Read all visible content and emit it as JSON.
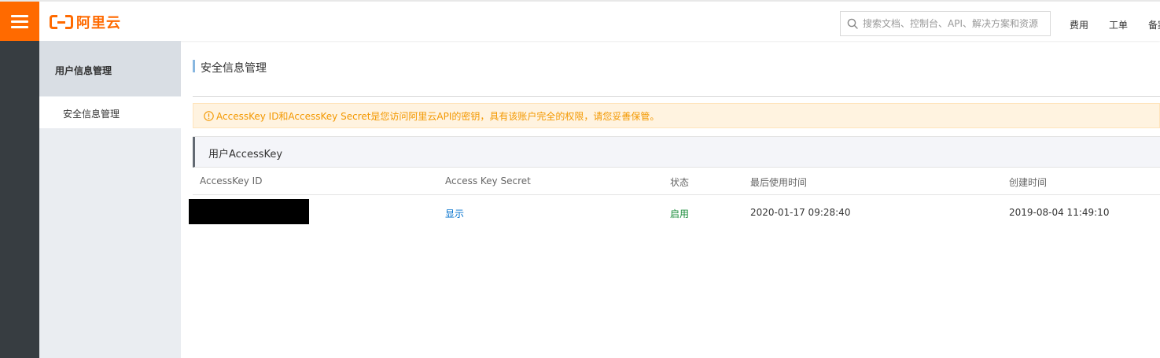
{
  "header": {
    "logo_text": "阿里云",
    "search_placeholder": "搜索文档、控制台、API、解决方案和资源",
    "links": [
      "费用",
      "工单",
      "备案"
    ]
  },
  "sidebar": {
    "group_title": "用户信息管理",
    "items": [
      {
        "label": "安全信息管理",
        "active": true
      }
    ]
  },
  "main": {
    "page_title": "安全信息管理",
    "alert_text": "AccessKey ID和AccessKey Secret是您访问阿里云API的密钥，具有该账户完全的权限，请您妥善保管。",
    "panel_title": "用户AccessKey",
    "table": {
      "columns": [
        "AccessKey ID",
        "Access Key Secret",
        "状态",
        "最后使用时间",
        "创建时间"
      ],
      "rows": [
        {
          "access_key_id": "",
          "secret_action": "显示",
          "status": "启用",
          "last_used": "2020-01-17 09:28:40",
          "created": "2019-08-04 11:49:10"
        }
      ]
    }
  },
  "colors": {
    "brand_orange": "#ff6a00",
    "alert_text": "#f39800",
    "link_blue": "#0070cc",
    "status_green": "#1e8e3e"
  },
  "icons": [
    "menu-icon",
    "aliyun-logo",
    "search-icon",
    "warning-circle-icon"
  ]
}
